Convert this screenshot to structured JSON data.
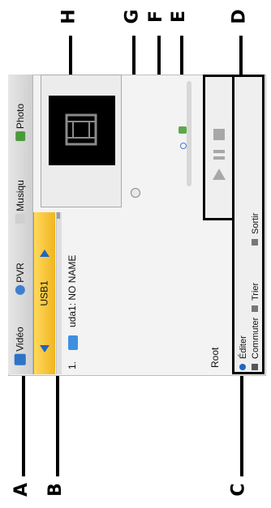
{
  "callouts": {
    "A": "A",
    "B": "B",
    "C": "C",
    "D": "D",
    "E": "E",
    "F": "F",
    "G": "G",
    "H": "H"
  },
  "tabs": [
    {
      "label": "Vidéo",
      "icon": "video-icon",
      "color": "#2e73c8"
    },
    {
      "label": "PVR",
      "icon": "pvr-icon",
      "color": "#3f7fd0"
    },
    {
      "label": "Musiqu",
      "icon": "music-icon",
      "color": "#9a9a9a"
    },
    {
      "label": "Photo",
      "icon": "photo-icon",
      "color": "#4a9a3c"
    }
  ],
  "usb": {
    "label": "USB1"
  },
  "file_list": {
    "items": [
      {
        "index": "1.",
        "name": "uda1: NO NAME"
      }
    ],
    "root_label": "Root"
  },
  "hints": {
    "edit": "Éditer",
    "switch": "Commuter",
    "sort": "Trier",
    "exit": "Sortir"
  },
  "colors": {
    "accent_yellow": "#f2b620",
    "accent_blue": "#1f65c4"
  }
}
